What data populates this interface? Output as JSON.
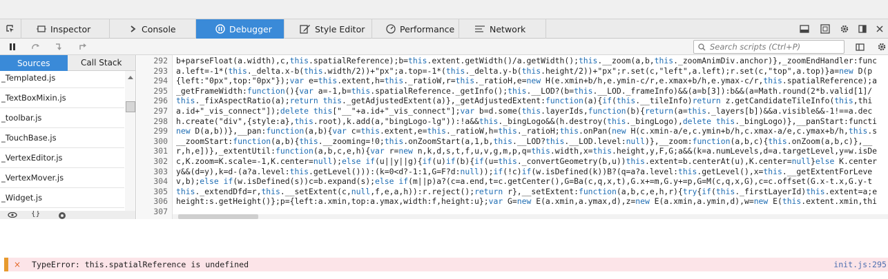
{
  "devtools": {
    "tabs": [
      {
        "label": "Inspector",
        "icon": "inspector-icon",
        "selected": false
      },
      {
        "label": "Console",
        "icon": "console-icon",
        "selected": false
      },
      {
        "label": "Debugger",
        "icon": "debugger-icon",
        "selected": true
      },
      {
        "label": "Style Editor",
        "icon": "style-editor-icon",
        "selected": false
      },
      {
        "label": "Performance",
        "icon": "performance-icon",
        "selected": false
      },
      {
        "label": "Network",
        "icon": "network-icon",
        "selected": false
      }
    ],
    "right_icons": [
      "split-console-icon",
      "responsive-mode-icon",
      "settings-icon",
      "dock-side-icon",
      "close-icon"
    ]
  },
  "debugger": {
    "toolbar": {
      "buttons": [
        "pause-icon",
        "step-over-icon",
        "step-in-icon",
        "step-out-icon"
      ],
      "search_placeholder": "Search scripts (Ctrl+P)",
      "right_icons": [
        "toggle-panes-icon",
        "options-icon"
      ]
    },
    "side_tabs": {
      "sources": "Sources",
      "call_stack": "Call Stack"
    },
    "sources": [
      "_Templated.js",
      "_TextBoxMixin.js",
      "_toolbar.js",
      "_TouchBase.js",
      "_VertexEditor.js",
      "_VertexMover.js",
      "_Widget.js"
    ],
    "bottom_icons": [
      "blackbox-icon",
      "pretty-print-icon",
      "blackbox-circle-icon"
    ],
    "lines": [
      {
        "n": "292",
        "code": "b+parseFloat(a.width),c,this.spatialReference);b=this.extent.getWidth()/a.getWidth();this.__zoom(a,b,this._zoomAnimDiv.anchor)},_zoomEndHandler:func"
      },
      {
        "n": "293",
        "code": "a.left=-1*(this._delta.x-b(this.width/2))+\"px\";a.top=-1*(this._delta.y-b(this.height/2))+\"px\";r.set(c,\"left\",a.left);r.set(c,\"top\",a.top)}a=new D(p"
      },
      {
        "n": "294",
        "code": "{left:\"0px\",top:\"0px\"});var e=this.extent,h=this._ratioW,r=this._ratioH,e=new H(e.xmin+b/h,e.ymin-c/r,e.xmax+b/h,e.ymax-c/r,this.spatialReference);a"
      },
      {
        "n": "295",
        "code": "_getFrameWidth:function(){var a=-1,b=this.spatialReference._getInfo();this.__LOD?(b=this.__LOD._frameInfo)&&(a=b[3]):b&&(a=Math.round(2*b.valid[1]/"
      },
      {
        "n": "296",
        "code": "this._fixAspectRatio(a);return this._getAdjustedExtent(a)},_getAdjustedExtent:function(a){if(this.__tileInfo)return z.getCandidateTileInfo(this,thi"
      },
      {
        "n": "297",
        "code": "a.id+\"_vis_connect\"]);delete this[\"__\"+a.id+\"_vis_connect\"];var b=d.some(this.layerIds,function(b){return(a=this._layers[b])&&a.visible&&-1!==a.dec"
      },
      {
        "n": "298",
        "code": "h.create(\"div\",{style:a},this.root),k.add(a,\"bingLogo-lg\")):!a&&this._bingLogo&&(h.destroy(this._bingLogo),delete this._bingLogo)},__panStart:functi"
      },
      {
        "n": "299",
        "code": "new D(a,b))},__pan:function(a,b){var c=this.extent,e=this._ratioW,h=this._ratioH;this.onPan(new H(c.xmin-a/e,c.ymin+b/h,c.xmax-a/e,c.ymax+b/h,this.s"
      },
      {
        "n": "300",
        "code": "__zoomStart:function(a,b){this.__zooming=!0;this.onZoomStart(a,1,b,this.__LOD?this.__LOD.level:null)},__zoom:function(a,b,c){this.onZoom(a,b,c)},__"
      },
      {
        "n": "301",
        "code": "r,h,e])},_extentUtil:function(a,b,c,e,h){var r=new n,k,d,s,t,f,u,v,g,m,p,q=this.width,x=this.height,y,F,G;a&&(k=a.numLevels,d=a.targetLevel,y=w.isDe"
      },
      {
        "n": "302",
        "code": "c,K.zoom=K.scale=-1,K.center=null);else if(u||y||g){if(u)if(b){if(u=this._convertGeometry(b,u))this.extent=b.centerAt(u),K.center=null}else K.center"
      },
      {
        "n": "303",
        "code": "y&&(d=y),k=d-(a?a.level:this.getLevel())):(k=0<d?-1:1,G=F?d:null));if(!c)if(w.isDefined(k))B?(q=a?a.level:this.getLevel(),x=this.__getExtentForLeve"
      },
      {
        "n": "304",
        "code": "v,b);else if(w.isDefined(s))c=b.expand(s);else if(m||p)a?(c=a.end,t=c.getCenter(),G=Ba(c,q,x,t),G.x+=m,G.y+=p,G=M(c,q,x,G),c=c.offset(G.x-t.x,G.y-t"
      },
      {
        "n": "305",
        "code": "this._extendDfd=r,this.__setExtent(c,null,f,e,a,h)):r.reject();return r},__setExtent:function(a,b,c,e,h,r){try{if(this._firstLayerId)this.extent=a;e"
      },
      {
        "n": "306",
        "code": "height:s.getHeight()};p={left:a.xmin,top:a.ymax,width:f,height:u};var G=new E(a.xmin,a.ymax,d),z=new E(a.xmin,a.ymin,d),w=new E(this.extent.xmin,thi"
      },
      {
        "n": "307",
        "code": ""
      }
    ]
  },
  "console": {
    "error_icon": "error-x-icon",
    "error_symbol": "×",
    "error_message": "TypeError: this.spatialReference is undefined",
    "error_location": "init.js:295"
  },
  "colors": {
    "accent": "#3a8ad8",
    "error_bg": "#fce4e8",
    "error_marker": "#e79a2e",
    "keyword": "#1f6db3"
  }
}
